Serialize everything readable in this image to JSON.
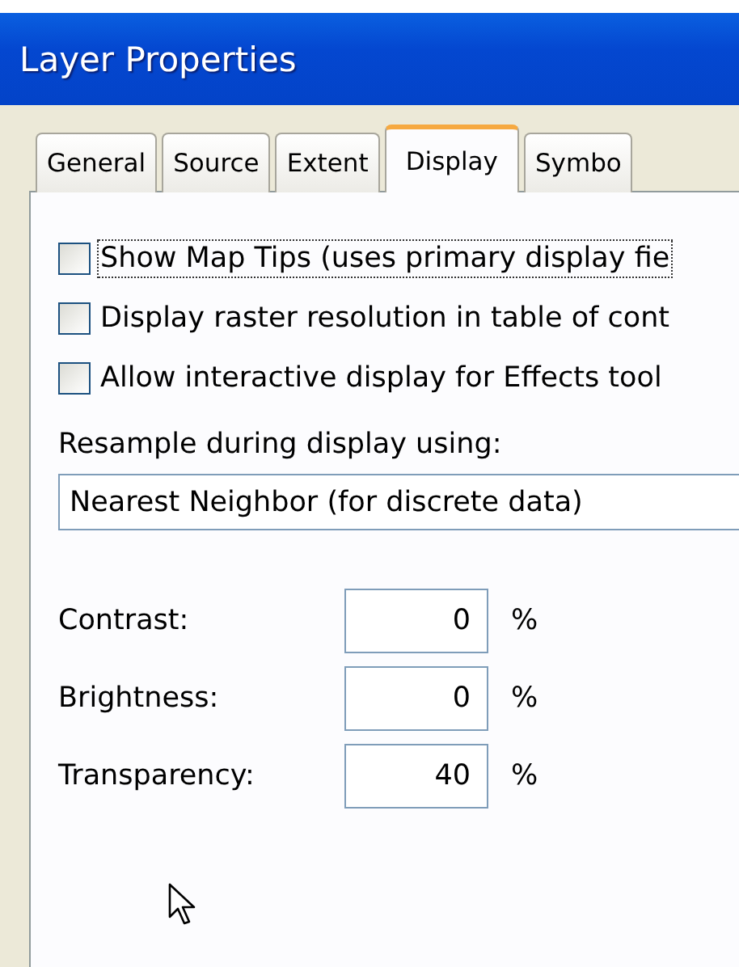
{
  "window": {
    "title": "Layer Properties"
  },
  "tabs": [
    {
      "label": "General",
      "selected": false
    },
    {
      "label": "Source",
      "selected": false
    },
    {
      "label": "Extent",
      "selected": false
    },
    {
      "label": "Display",
      "selected": true
    },
    {
      "label": "Symbo",
      "selected": false
    }
  ],
  "options": [
    {
      "label": "Show Map Tips (uses primary display fie",
      "checked": false,
      "focused": true
    },
    {
      "label": "Display raster resolution in table of cont",
      "checked": false,
      "focused": false
    },
    {
      "label": "Allow interactive display for Effects tool",
      "checked": false,
      "focused": false
    }
  ],
  "resample": {
    "label": "Resample during display using:",
    "value": "Nearest Neighbor (for discrete data)"
  },
  "adjustments": [
    {
      "label": "Contrast:",
      "value": "0",
      "unit": "%"
    },
    {
      "label": "Brightness:",
      "value": "0",
      "unit": "%"
    },
    {
      "label": "Transparency:",
      "value": "40",
      "unit": "%"
    }
  ]
}
